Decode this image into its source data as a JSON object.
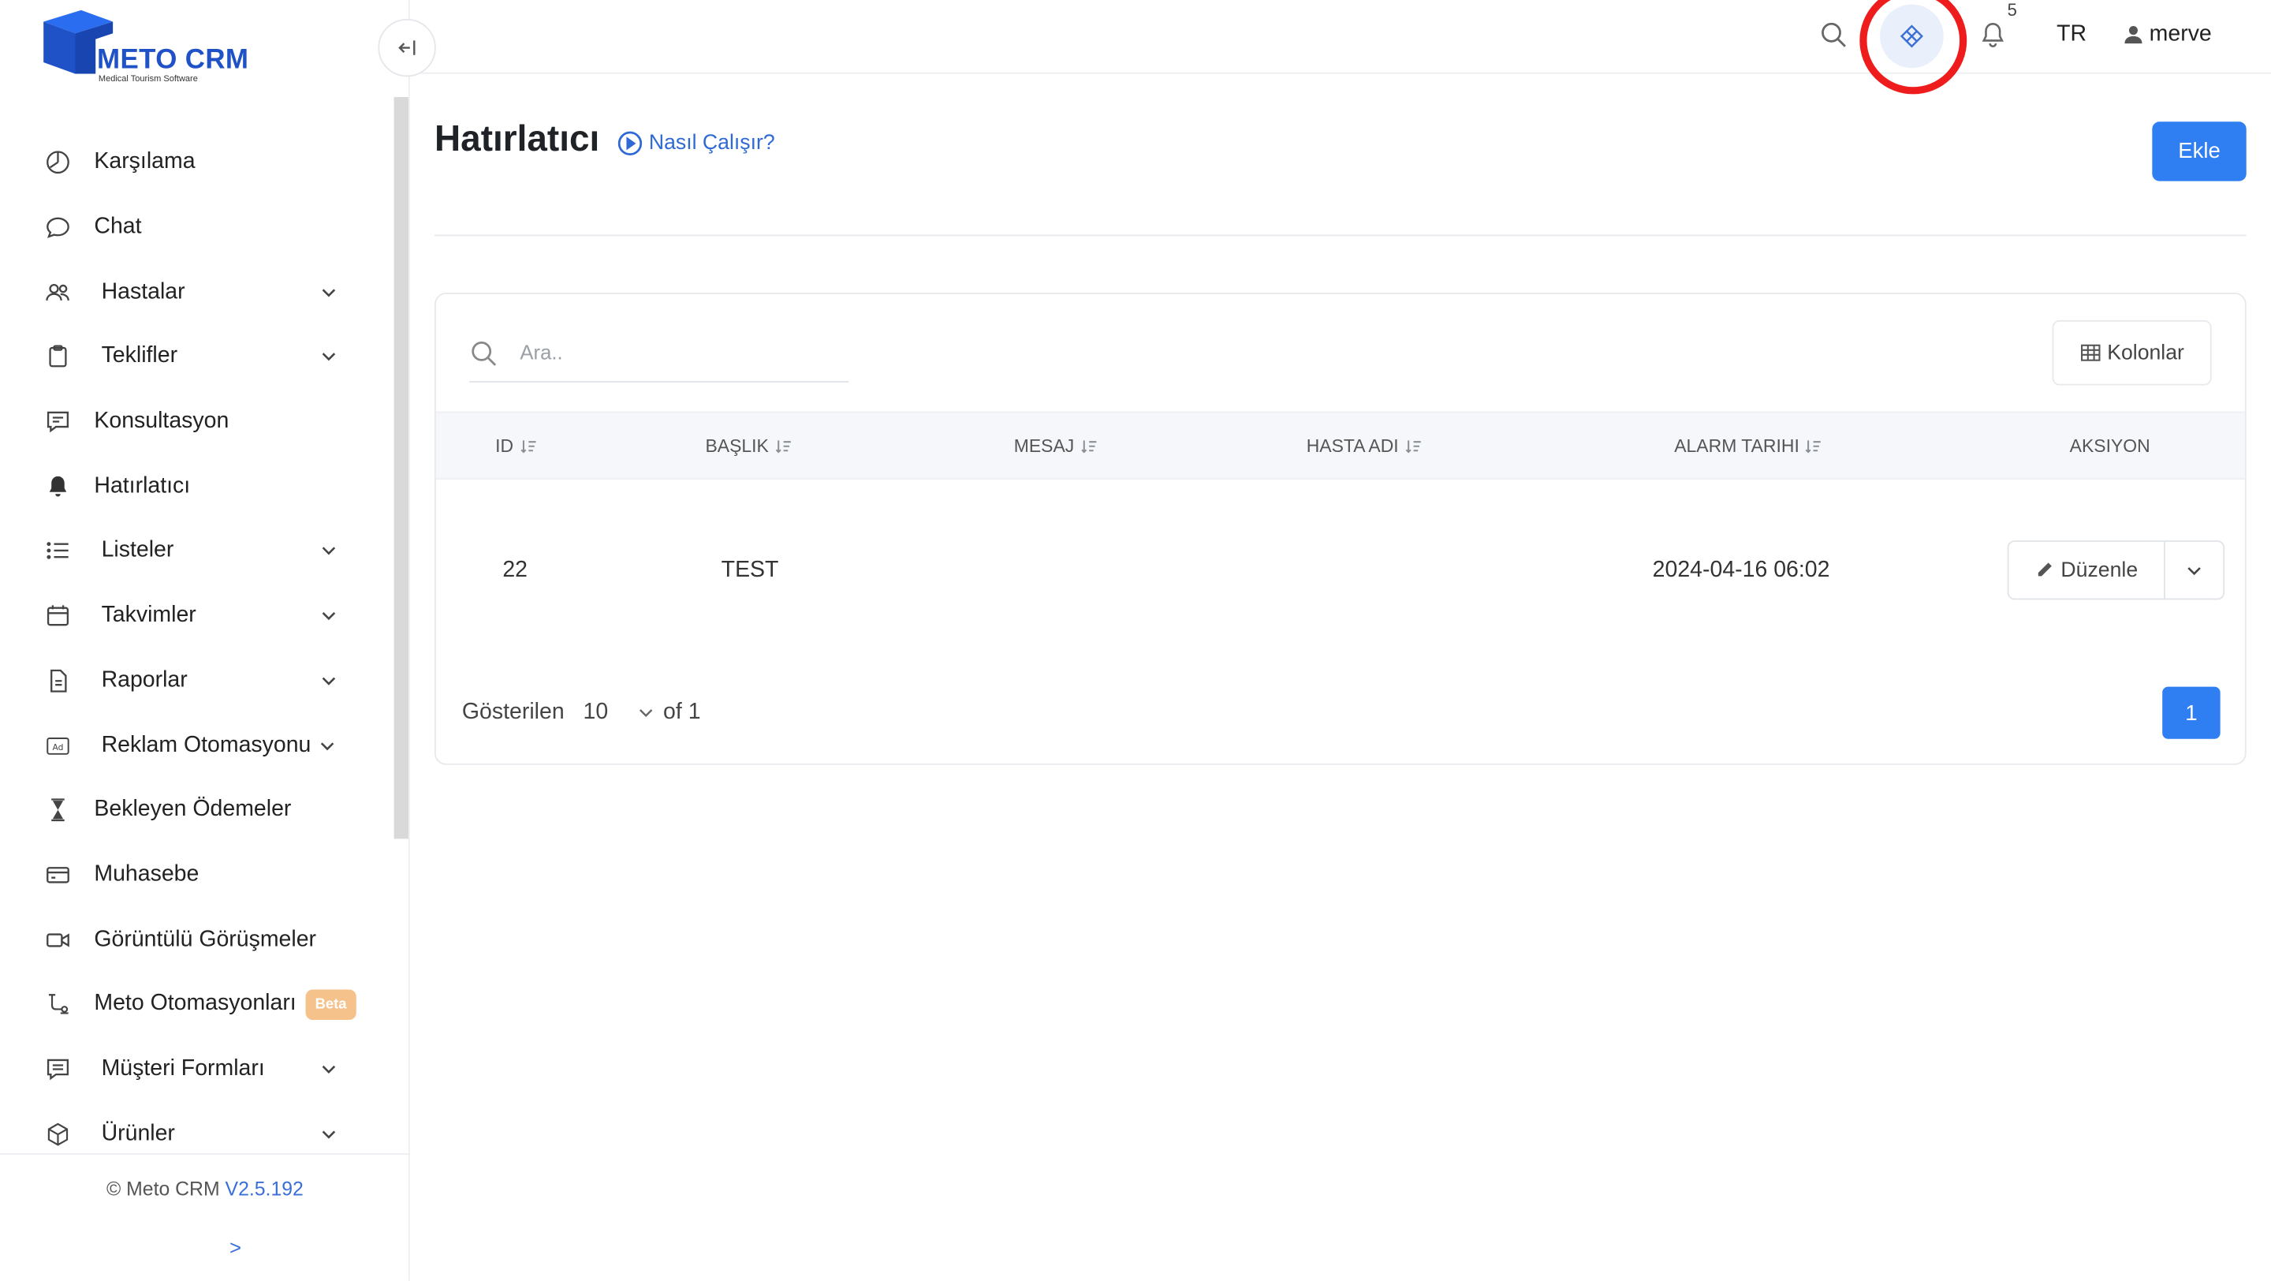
{
  "brand": {
    "name": "METO CRM",
    "tagline": "Medical Tourism Software",
    "primary_color": "#1f52c7",
    "accent_color": "#2f7ff2"
  },
  "sidebar": {
    "items": [
      {
        "label": "Karşılama",
        "icon": "dashboard-gauge-icon",
        "submenu": false
      },
      {
        "label": "Chat",
        "icon": "chat-bubble-icon",
        "submenu": false
      },
      {
        "label": "Hastalar",
        "icon": "users-icon",
        "submenu": true
      },
      {
        "label": "Teklifler",
        "icon": "clipboard-icon",
        "submenu": true
      },
      {
        "label": "Konsultasyon",
        "icon": "message-square-icon",
        "submenu": false
      },
      {
        "label": "Hatırlatıcı",
        "icon": "bell-filled-icon",
        "submenu": false,
        "active": true
      },
      {
        "label": "Listeler",
        "icon": "list-icon",
        "submenu": true
      },
      {
        "label": "Takvimler",
        "icon": "calendar-icon",
        "submenu": true
      },
      {
        "label": "Raporlar",
        "icon": "document-icon",
        "submenu": true
      },
      {
        "label": "Reklam Otomasyonu",
        "icon": "ad-icon",
        "submenu": true
      },
      {
        "label": "Bekleyen Ödemeler",
        "icon": "hourglass-icon",
        "submenu": false
      },
      {
        "label": "Muhasebe",
        "icon": "credit-card-icon",
        "submenu": false
      },
      {
        "label": "Görüntülü Görüşmeler",
        "icon": "video-camera-icon",
        "submenu": false
      },
      {
        "label": "Meto Otomasyonları",
        "icon": "flow-automation-icon",
        "submenu": false,
        "badge": "Beta"
      },
      {
        "label": "Müşteri Formları",
        "icon": "form-icon",
        "submenu": true
      },
      {
        "label": "Ürünler",
        "icon": "box-icon",
        "submenu": true
      }
    ],
    "footer": {
      "copyright": "© Meto CRM",
      "version": "V2.5.192",
      "expand": ">"
    }
  },
  "topbar": {
    "notification_count": "5",
    "language": "TR",
    "user": "merve"
  },
  "page": {
    "title": "Hatırlatıcı",
    "help_link": "Nasıl Çalışır?",
    "add_button": "Ekle"
  },
  "table": {
    "search_placeholder": "Ara..",
    "columns_button": "Kolonlar",
    "headers": [
      "ID",
      "BAŞLIK",
      "MESAJ",
      "HASTA ADI",
      "ALARM TARIHI",
      "AKSIYON"
    ],
    "rows": [
      {
        "id": "22",
        "title": "TEST",
        "message": "",
        "patient": "",
        "alarm_date": "2024-04-16 06:02",
        "action": "Düzenle"
      }
    ],
    "pagination": {
      "shown_label": "Gösterilen",
      "page_size": "10",
      "of_label": "of 1",
      "current_page": "1"
    }
  }
}
